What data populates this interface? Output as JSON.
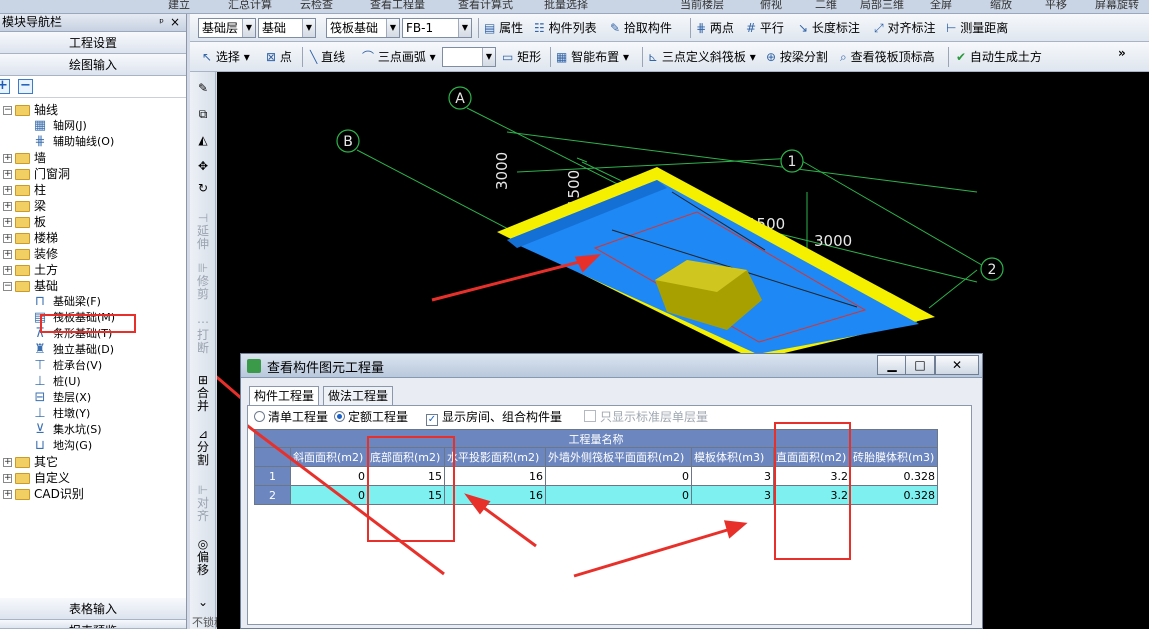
{
  "topstrip": [
    "建立",
    "汇总计算",
    "云检查",
    "查看工程量",
    "查看计算式",
    "批量选择",
    "当前楼层",
    "俯视",
    "二维",
    "局部三维",
    "全屏",
    "缩放",
    "平移",
    "屏幕旋转"
  ],
  "left_panel": {
    "title": "模块导航栏",
    "pin": "ᵖ",
    "close": "×",
    "btn_project_settings": "工程设置",
    "btn_drawing_input": "绘图输入",
    "btn_table_input": "表格输入",
    "btn_report": "报表预览",
    "tree": [
      {
        "label": "轴线",
        "level": 0,
        "expanded": true
      },
      {
        "label": "轴网(J)",
        "level": 1
      },
      {
        "label": "辅助轴线(O)",
        "level": 1
      },
      {
        "label": "墙",
        "level": 0
      },
      {
        "label": "门窗洞",
        "level": 0
      },
      {
        "label": "柱",
        "level": 0
      },
      {
        "label": "梁",
        "level": 0
      },
      {
        "label": "板",
        "level": 0
      },
      {
        "label": "楼梯",
        "level": 0
      },
      {
        "label": "装修",
        "level": 0
      },
      {
        "label": "土方",
        "level": 0
      },
      {
        "label": "基础",
        "level": 0,
        "expanded": true
      },
      {
        "label": "基础梁(F)",
        "level": 1
      },
      {
        "label": "筏板基础(M)",
        "level": 1
      },
      {
        "label": "条形基础(T)",
        "level": 1
      },
      {
        "label": "独立基础(D)",
        "level": 1
      },
      {
        "label": "桩承台(V)",
        "level": 1
      },
      {
        "label": "桩(U)",
        "level": 1
      },
      {
        "label": "垫层(X)",
        "level": 1
      },
      {
        "label": "柱墩(Y)",
        "level": 1
      },
      {
        "label": "集水坑(S)",
        "level": 1
      },
      {
        "label": "地沟(G)",
        "level": 1
      },
      {
        "label": "其它",
        "level": 0
      },
      {
        "label": "自定义",
        "level": 0
      },
      {
        "label": "CAD识别",
        "level": 0
      }
    ]
  },
  "toolbar1": {
    "layer": "基础层",
    "category": "基础",
    "type": "筏板基础",
    "member": "FB-1",
    "items": [
      "属性",
      "构件列表",
      "拾取构件",
      "两点",
      "平行",
      "长度标注",
      "对齐标注",
      "测量距离"
    ]
  },
  "toolbar2": {
    "select": "选择",
    "point": "点",
    "line": "直线",
    "arc": "三点画弧",
    "rect": "矩形",
    "smart": "智能布置",
    "slope": "三点定义斜筏板",
    "split": "按梁分割",
    "elev": "查看筏板顶标高",
    "auto": "自动生成土方",
    "more": "»"
  },
  "vtoolbar": [
    "延伸",
    "修剪",
    "打断",
    "合并",
    "分割",
    "对齐",
    "偏移"
  ],
  "viewport": {
    "axis_labels": [
      "A",
      "B",
      "1",
      "2"
    ],
    "dims": [
      "3000",
      "1500",
      "1500",
      "3000"
    ]
  },
  "dialog": {
    "title": "查看构件图元工程量",
    "minimize": "▁",
    "maximize": "□",
    "close": "✕",
    "tabs": [
      "构件工程量",
      "做法工程量"
    ],
    "options": {
      "qd": "清单工程量",
      "de": "定额工程量",
      "show_rooms": "显示房间、组合构件量",
      "std_only": "只显示标准层单层量"
    },
    "table": {
      "group_header": "工程量名称",
      "columns": [
        "斜面面积(m2)",
        "底部面积(m2)",
        "水平投影面积(m2)",
        "外墙外侧筏板平面面积(m2)",
        "模板体积(m3)",
        "直面面积(m2)",
        "砖胎膜体积(m3)"
      ],
      "rows": [
        {
          "id": "1",
          "values": [
            "0",
            "15",
            "16",
            "0",
            "3",
            "3.2",
            "0.328"
          ]
        },
        {
          "id": "2",
          "values": [
            "0",
            "15",
            "16",
            "0",
            "3",
            "3.2",
            "0.328"
          ]
        }
      ]
    }
  },
  "status": "不锁移"
}
